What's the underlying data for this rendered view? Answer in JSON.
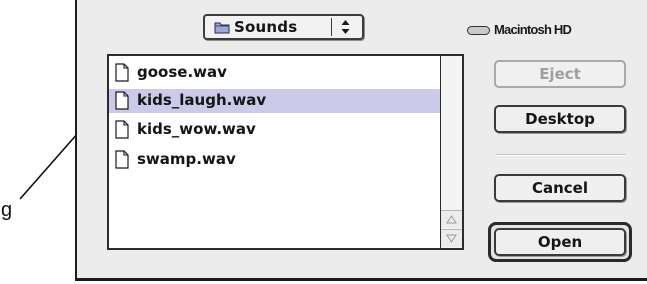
{
  "folder_popup": {
    "label": "Sounds",
    "icon": "folder-icon"
  },
  "volume": {
    "label": "Macintosh HD",
    "icon": "hard-drive-icon"
  },
  "file_list": {
    "files": [
      {
        "name": "goose.wav",
        "selected": false
      },
      {
        "name": "kids_laugh.wav",
        "selected": true
      },
      {
        "name": "kids_wow.wav",
        "selected": false
      },
      {
        "name": "swamp.wav",
        "selected": false
      }
    ]
  },
  "buttons": {
    "eject": "Eject",
    "desktop": "Desktop",
    "cancel": "Cancel",
    "open": "Open"
  },
  "annotation": {
    "label": "g"
  },
  "colors": {
    "selection": "#cbcbe9",
    "dialog_background": "#ececec"
  }
}
